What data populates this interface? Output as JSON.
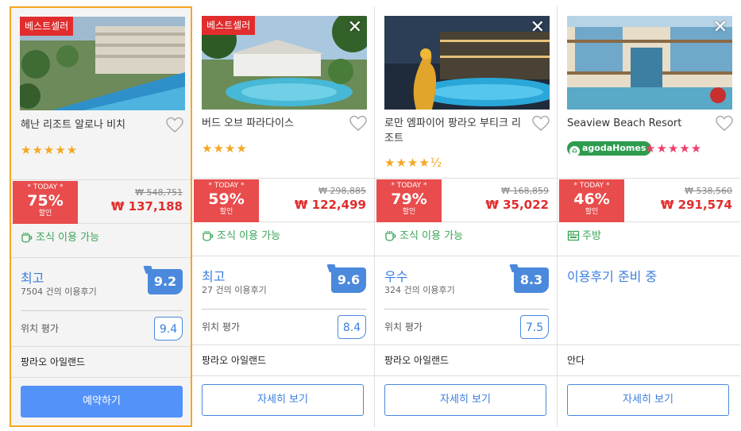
{
  "hotels": [
    {
      "badge": "베스트셀러",
      "name": "헤난 리조트 알로나 비치",
      "stars": "★★★★★",
      "today": "* TODAY *",
      "discount": "75%",
      "discount_label": "할인",
      "original_price": "₩ 548,751",
      "final_price": "₩ 137,188",
      "amenity": "조식 이용 가능",
      "review_label": "최고",
      "review_count": "7504 건의 이용후기",
      "score": "9.2",
      "location_label": "위치 평가",
      "location_score": "9.4",
      "area": "팡라오 아일랜드",
      "button": "예약하기"
    },
    {
      "badge": "베스트셀러",
      "name": "버드 오브 파라다이스",
      "stars": "★★★★",
      "today": "* TODAY *",
      "discount": "59%",
      "discount_label": "할인",
      "original_price": "₩ 298,885",
      "final_price": "₩ 122,499",
      "amenity": "조식 이용 가능",
      "review_label": "최고",
      "review_count": "27 건의 이용후기",
      "score": "9.6",
      "location_label": "위치 평가",
      "location_score": "8.4",
      "area": "팡라오 아일랜드",
      "button": "자세히 보기",
      "close": "✕"
    },
    {
      "name": "로만 엠파이어 팡라오 부티크 리조트",
      "stars": "★★★★½",
      "today": "* TODAY *",
      "discount": "79%",
      "discount_label": "할인",
      "original_price": "₩ 168,859",
      "final_price": "₩ 35,022",
      "amenity": "조식 이용 가능",
      "review_label": "우수",
      "review_count": "324 건의 이용후기",
      "score": "8.3",
      "location_label": "위치 평가",
      "location_score": "7.5",
      "area": "팡라오 아일랜드",
      "button": "자세히 보기",
      "close": "✕"
    },
    {
      "name": "Seaview Beach Resort",
      "agoda": "agodaHomes",
      "stars": "★★★★★",
      "today": "* TODAY *",
      "discount": "46%",
      "discount_label": "할인",
      "original_price": "₩ 538,560",
      "final_price": "₩ 291,574",
      "amenity": "주방",
      "review_pending": "이용후기 준비 중",
      "area": "안다",
      "button": "자세히 보기",
      "close": "✕"
    }
  ],
  "colors": {
    "accent": "#4a89dc",
    "discount": "#e84c4c",
    "price": "#e12d2d",
    "selected_border": "#f5a623",
    "amenity_green": "#3aa357"
  }
}
